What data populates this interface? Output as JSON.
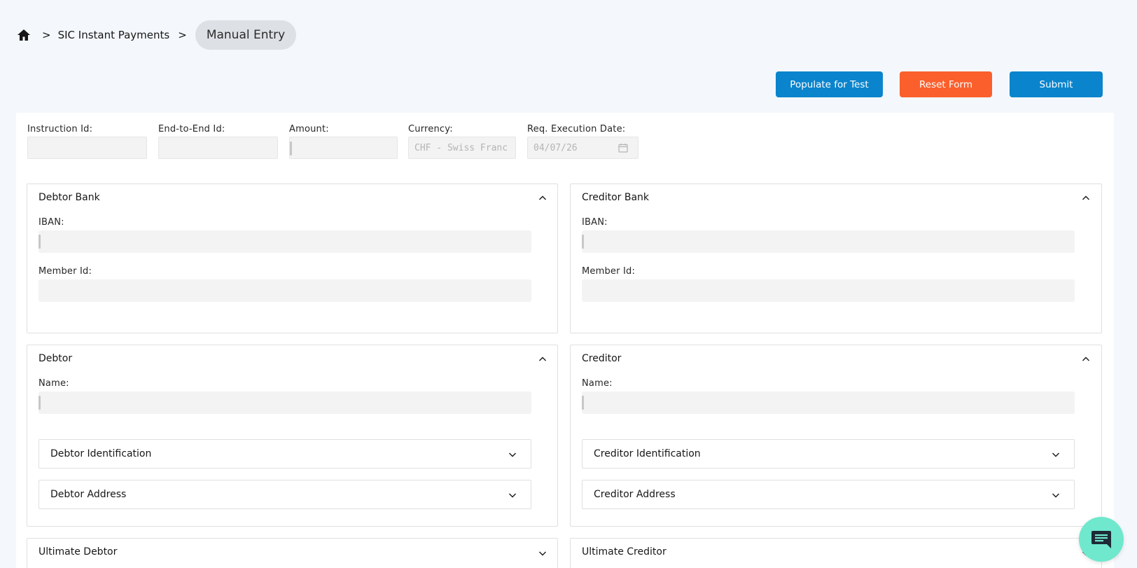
{
  "breadcrumb": {
    "home_icon": "home-icon",
    "separator": ">",
    "items": [
      "SIC Instant Payments"
    ],
    "current": "Manual Entry"
  },
  "toolbar": {
    "populate_label": "Populate for Test",
    "reset_label": "Reset Form",
    "submit_label": "Submit"
  },
  "header_fields": {
    "instruction_id": {
      "label": "Instruction Id:",
      "value": ""
    },
    "end_to_end_id": {
      "label": "End-to-End Id:",
      "value": ""
    },
    "amount": {
      "label": "Amount:",
      "value": ""
    },
    "currency": {
      "label": "Currency:",
      "value": "CHF - Swiss Franc"
    },
    "exec_date": {
      "label": "Req. Execution Date:",
      "value": "04/07/26",
      "icon": "calendar-icon"
    }
  },
  "debtor_bank": {
    "title": "Debtor Bank",
    "iban_label": "IBAN:",
    "member_label": "Member Id:"
  },
  "creditor_bank": {
    "title": "Creditor Bank",
    "iban_label": "IBAN:",
    "member_label": "Member Id:"
  },
  "debtor": {
    "title": "Debtor",
    "name_label": "Name:",
    "identification": "Debtor Identification",
    "address": "Debtor Address"
  },
  "creditor": {
    "title": "Creditor",
    "name_label": "Name:",
    "identification": "Creditor Identification",
    "address": "Creditor Address"
  },
  "ultimate_debtor": {
    "title": "Ultimate Debtor"
  },
  "ultimate_creditor": {
    "title": "Ultimate Creditor"
  },
  "chat": {
    "icon": "chat-icon"
  },
  "colors": {
    "primary": "#0a84cc",
    "danger": "#fb5f2c",
    "chat": "#6fe8cd",
    "background": "#f4f8fc"
  }
}
